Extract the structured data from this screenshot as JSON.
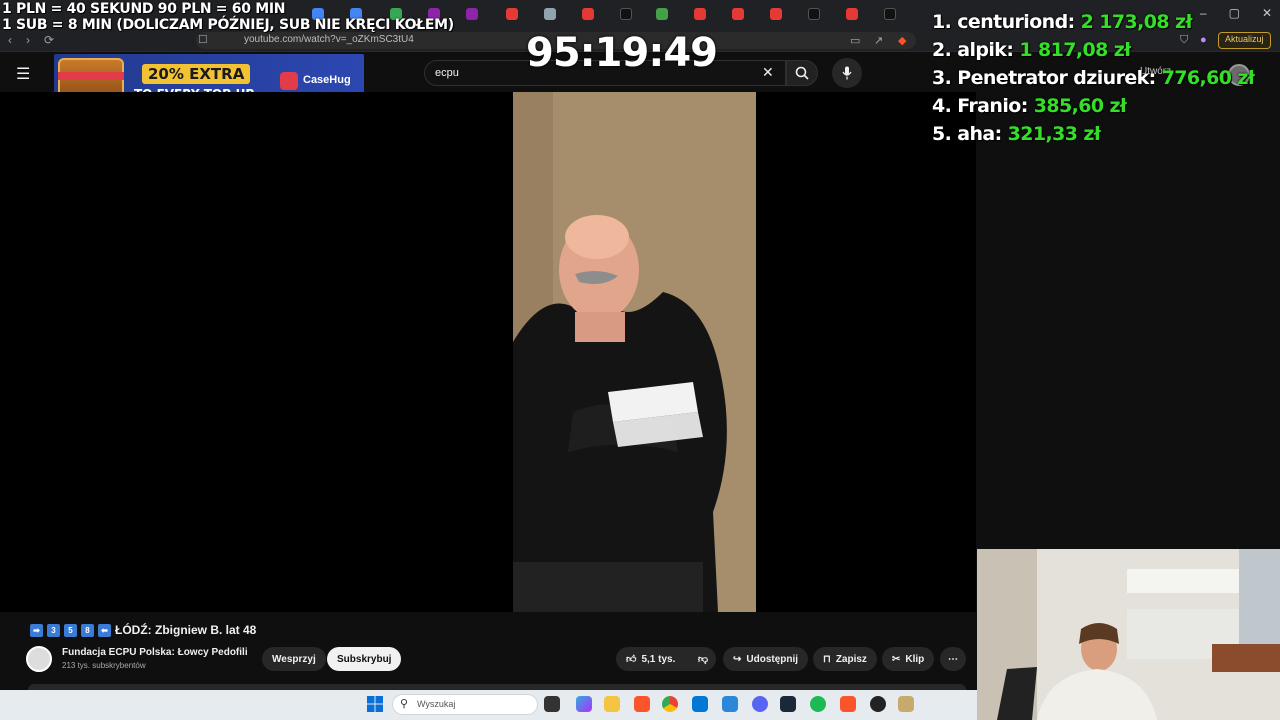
{
  "overlay": {
    "rates_line1": "1 PLN = 40 SEKUND 90 PLN = 60 MIN",
    "rates_line2": "1 SUB = 8 MIN (DOLICZAM PÓŹNIEJ, SUB NIE KRĘCI KOŁEM)",
    "timer": "95:19:49",
    "leaderboard": [
      {
        "name": "1. centuriond:",
        "amount": "2 173,08 zł"
      },
      {
        "name": "2. alpik:",
        "amount": "1 817,08 zł"
      },
      {
        "name": "3. Penetrator dziurek:",
        "amount": "776,60 zł"
      },
      {
        "name": "4. Franio:",
        "amount": "385,60 zł"
      },
      {
        "name": "5. aha:",
        "amount": "321,33 zł"
      }
    ]
  },
  "browser": {
    "url": "youtube.com/watch?v=_oZKmSC3tU4",
    "update_label": "Aktualizuj"
  },
  "youtube": {
    "search_value": "ecpu",
    "create_label": "Utwórz",
    "ad": {
      "headline": "20% EXTRA",
      "subline": "TO EVERY TOP-UP",
      "brand": "CaseHug"
    },
    "video": {
      "title": "ŁÓDŹ: Zbigniew B. lat 48",
      "title_digits": [
        "3",
        "5",
        "8"
      ],
      "channel": "Fundacja ECPU Polska: Łowcy Pedofili",
      "subscribers": "213 tys. subskrybentów",
      "support_label": "Wesprzyj",
      "subscribe_label": "Subskrybuj",
      "likes": "5,1 tys.",
      "share_label": "Udostępnij",
      "save_label": "Zapisz",
      "clip_label": "Klip"
    }
  },
  "taskbar": {
    "search_placeholder": "Wyszukaj"
  }
}
